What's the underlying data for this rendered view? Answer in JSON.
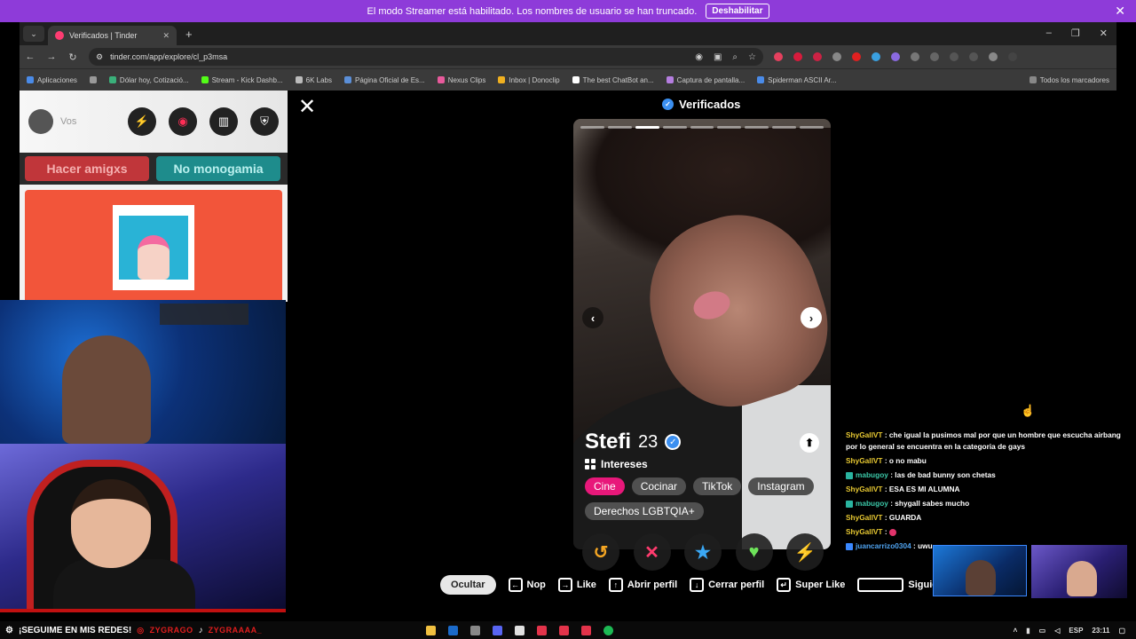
{
  "banner": {
    "text": "El modo Streamer está habilitado. Los nombres de usuario se han truncado.",
    "button": "Deshabilitar"
  },
  "browser": {
    "tab_title": "Verificados | Tinder",
    "url": "tinder.com/app/explore/cl_p3msa",
    "bookmarks": [
      "Aplicaciones",
      "Dólar hoy, Cotizació...",
      "Stream - Kick Dashb...",
      "6K Labs",
      "Página Oficial de Es...",
      "Nexus Clips",
      "Inbox | Donoclip",
      "The best ChatBot an...",
      "Captura de pantalla...",
      "Spiderman ASCII Ar..."
    ],
    "all_bookmarks": "Todos los marcadores"
  },
  "left_panel": {
    "user_label": "Vos",
    "tag1": "Hacer amigxs",
    "tag2": "No monogamia"
  },
  "header": {
    "title": "Verificados"
  },
  "profile": {
    "name": "Stefi",
    "age": "23",
    "interests_label": "Intereses",
    "interests": [
      "Cine",
      "Cocinar",
      "TikTok",
      "Instagram",
      "Derechos LGBTQIA+"
    ],
    "photo_count": 9,
    "current_photo": 3
  },
  "shortcuts": {
    "hide": "Ocultar",
    "nope": "Nop",
    "like": "Like",
    "open_profile": "Abrir perfil",
    "close_profile": "Cerrar perfil",
    "super_like": "Super Like",
    "next": "Siguie"
  },
  "chat": [
    {
      "user": "ShyGallVT",
      "text": ": che igual la pusimos mal por que un hombre que escucha airbang por lo general se encuentra en la categoria de gays"
    },
    {
      "user": "ShyGallVT",
      "text": ": o no mabu"
    },
    {
      "user": "mabugoy",
      "text": ": las de bad bunny son chetas"
    },
    {
      "user": "ShyGallVT",
      "text": ": ESA ES MI ALUMNA"
    },
    {
      "user": "mabugoy",
      "text": ": shygall sabes mucho"
    },
    {
      "user": "ShyGallVT",
      "text": ": GUARDA"
    },
    {
      "user": "ShyGallVT",
      "text": ":"
    },
    {
      "user": "juancarrizo0304",
      "text": ": uwu"
    }
  ],
  "bottom": {
    "follow": "¡SEGUIME EN MIS REDES!",
    "ig": "ZYGRAGO",
    "tt": "ZYGRAAAA_",
    "lang": "ESP",
    "time": "23:11"
  },
  "colors": {
    "banner": "#8e3bd9",
    "tinder_pink": "#e8187a",
    "verified_blue": "#3b8ff0"
  }
}
